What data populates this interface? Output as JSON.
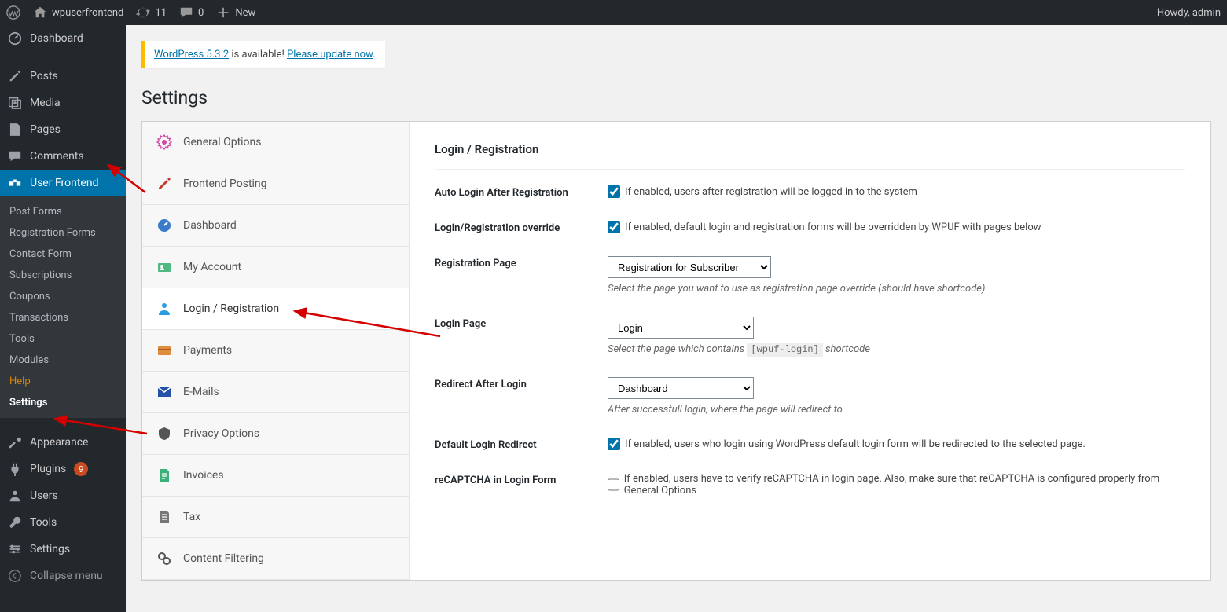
{
  "adminbar": {
    "site": "wpuserfrontend",
    "updates": "11",
    "comments": "0",
    "new": "New",
    "howdy": "Howdy, admin"
  },
  "sidebar": {
    "dashboard": "Dashboard",
    "posts": "Posts",
    "media": "Media",
    "pages": "Pages",
    "comments": "Comments",
    "user_frontend": "User Frontend",
    "submenu": {
      "post_forms": "Post Forms",
      "registration_forms": "Registration Forms",
      "contact_form": "Contact Form",
      "subscriptions": "Subscriptions",
      "coupons": "Coupons",
      "transactions": "Transactions",
      "tools": "Tools",
      "modules": "Modules",
      "help": "Help",
      "settings": "Settings"
    },
    "appearance": "Appearance",
    "plugins": "Plugins",
    "plugins_badge": "9",
    "users": "Users",
    "tools": "Tools",
    "settings": "Settings",
    "collapse": "Collapse menu"
  },
  "notice": {
    "version_link": "WordPress 5.3.2",
    "text_mid": " is available! ",
    "update_link": "Please update now",
    "period": "."
  },
  "page_title": "Settings",
  "tabs": {
    "general": "General Options",
    "frontend_posting": "Frontend Posting",
    "dashboard": "Dashboard",
    "my_account": "My Account",
    "login_reg": "Login / Registration",
    "payments": "Payments",
    "emails": "E-Mails",
    "privacy": "Privacy Options",
    "invoices": "Invoices",
    "tax": "Tax",
    "content_filtering": "Content Filtering"
  },
  "panel": {
    "heading": "Login / Registration",
    "rows": {
      "auto_login": {
        "label": "Auto Login After Registration",
        "desc": "If enabled, users after registration will be logged in to the system"
      },
      "override": {
        "label": "Login/Registration override",
        "desc": "If enabled, default login and registration forms will be overridden by WPUF with pages below"
      },
      "reg_page": {
        "label": "Registration Page",
        "select": "Registration for Subscriber",
        "desc": "Select the page you want to use as registration page override (should have shortcode)"
      },
      "login_page": {
        "label": "Login Page",
        "select": "Login",
        "desc_pre": "Select the page which contains ",
        "code": "[wpuf-login]",
        "desc_post": " shortcode"
      },
      "redirect": {
        "label": "Redirect After Login",
        "select": "Dashboard",
        "desc": "After successfull login, where the page will redirect to"
      },
      "default_redirect": {
        "label": "Default Login Redirect",
        "desc": "If enabled, users who login using WordPress default login form will be redirected to the selected page."
      },
      "recaptcha": {
        "label": "reCAPTCHA in Login Form",
        "desc": "If enabled, users have to verify reCAPTCHA in login page. Also, make sure that reCAPTCHA is configured properly from General Options"
      }
    }
  }
}
